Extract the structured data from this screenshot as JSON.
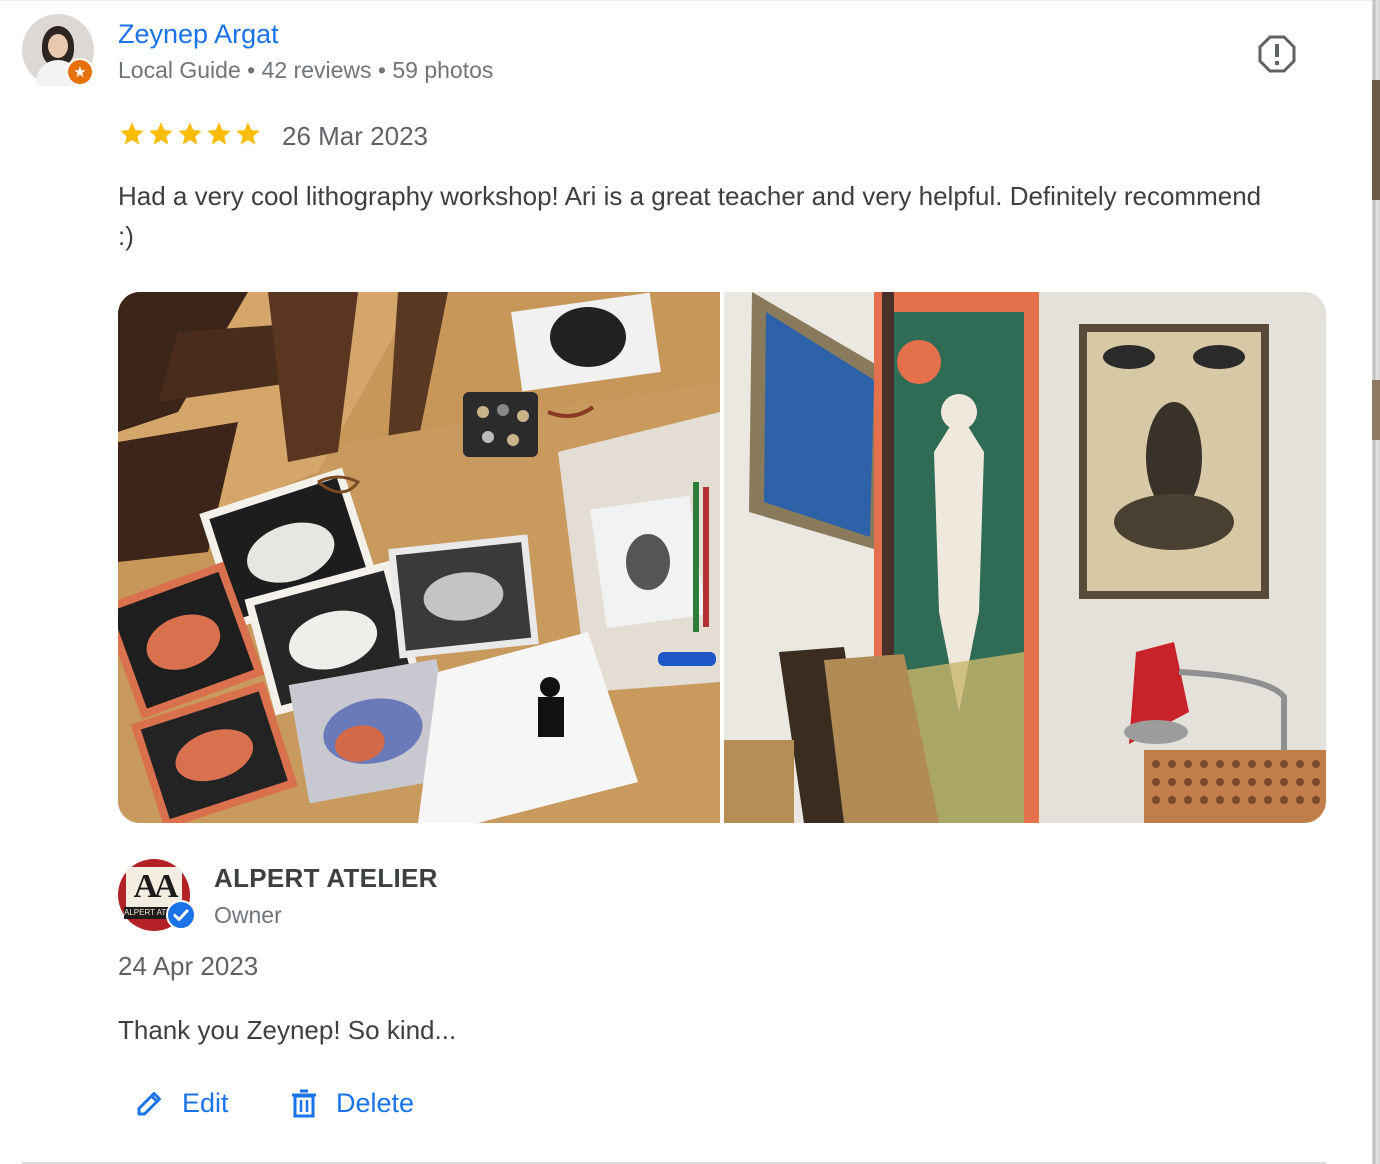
{
  "reviewer": {
    "name": "Zeynep Argat",
    "meta": "Local Guide • 42 reviews • 59 photos",
    "avatar_icon": "user-avatar",
    "badge_icon": "local-guide-star-icon",
    "badge_color": "#e8710a"
  },
  "review": {
    "rating": 5,
    "rating_max": 5,
    "star_color": "#fbbc04",
    "date": "26 Mar 2023",
    "text": "Had a very cool lithography workshop! Ari is a great teacher and very helpful. Definitely recommend :)"
  },
  "photos": [
    {
      "subject": "printmaking workshop table with linocut rabbit prints"
    },
    {
      "subject": "studio wall with framed prints and lamp"
    }
  ],
  "owner_reply": {
    "name": "ALPERT ATELIER",
    "role": "Owner",
    "logo_letters": "AA",
    "logo_strip": "ALPERT ATELIER",
    "verified_icon": "verified-badge-icon",
    "date": "24 Apr 2023",
    "text": "Thank you Zeynep! So kind..."
  },
  "actions": {
    "edit_label": "Edit",
    "delete_label": "Delete"
  },
  "colors": {
    "link_blue": "#1a73e8",
    "secondary_text": "#70757a",
    "body_text": "#3c4043"
  }
}
